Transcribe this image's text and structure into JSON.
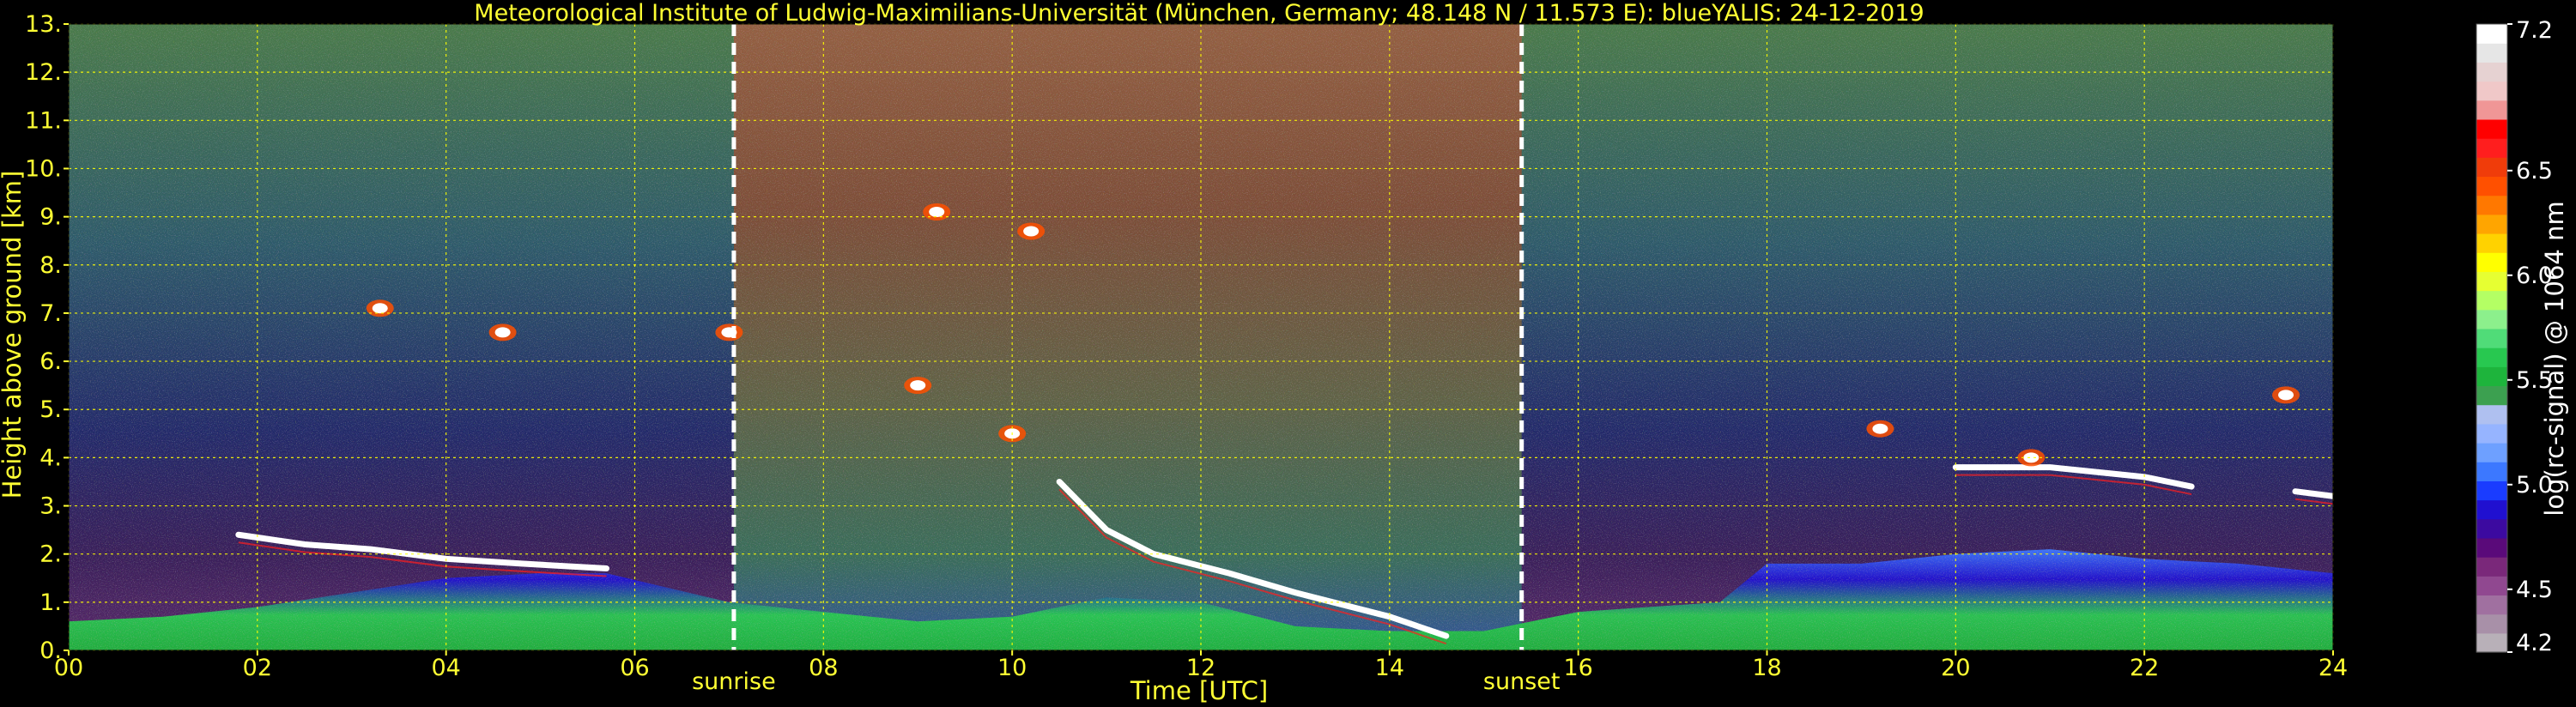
{
  "chart_data": {
    "type": "heatmap",
    "title": "Meteorological Institute of Ludwig-Maximilians-Universität (München, Germany; 48.148 N / 11.573 E):    blueYALIS: 24-12-2019",
    "xlabel": "Time [UTC]",
    "ylabel": "Height above ground [km]",
    "xlim": [
      0,
      24
    ],
    "ylim": [
      0,
      13
    ],
    "x_ticks": [
      {
        "value": 0,
        "label": "00"
      },
      {
        "value": 2,
        "label": "02"
      },
      {
        "value": 4,
        "label": "04"
      },
      {
        "value": 6,
        "label": "06"
      },
      {
        "value": 8,
        "label": "08"
      },
      {
        "value": 10,
        "label": "10"
      },
      {
        "value": 12,
        "label": "12"
      },
      {
        "value": 14,
        "label": "14"
      },
      {
        "value": 16,
        "label": "16"
      },
      {
        "value": 18,
        "label": "18"
      },
      {
        "value": 20,
        "label": "20"
      },
      {
        "value": 22,
        "label": "22"
      },
      {
        "value": 24,
        "label": "24"
      }
    ],
    "y_ticks": [
      {
        "value": 0,
        "label": "0."
      },
      {
        "value": 1,
        "label": "1."
      },
      {
        "value": 2,
        "label": "2."
      },
      {
        "value": 3,
        "label": "3."
      },
      {
        "value": 4,
        "label": "4."
      },
      {
        "value": 5,
        "label": "5."
      },
      {
        "value": 6,
        "label": "6."
      },
      {
        "value": 7,
        "label": "7."
      },
      {
        "value": 8,
        "label": "8."
      },
      {
        "value": 9,
        "label": "9."
      },
      {
        "value": 10,
        "label": "10."
      },
      {
        "value": 11,
        "label": "11."
      },
      {
        "value": 12,
        "label": "12."
      },
      {
        "value": 13,
        "label": "13."
      }
    ],
    "grid": true,
    "grid_color": "#ffff00",
    "markers": [
      {
        "label": "sunrise",
        "time": 7.05
      },
      {
        "label": "sunset",
        "time": 15.4
      }
    ],
    "colorbar": {
      "label": "log(rc-signal) @ 1064 nm",
      "range": [
        4.2,
        7.2
      ],
      "ticks": [
        {
          "value": 4.2,
          "label": "4.2"
        },
        {
          "value": 4.5,
          "label": "4.5"
        },
        {
          "value": 5.0,
          "label": "5.0"
        },
        {
          "value": 5.5,
          "label": "5.5"
        },
        {
          "value": 6.0,
          "label": "6.0"
        },
        {
          "value": 6.5,
          "label": "6.5"
        },
        {
          "value": 7.2,
          "label": "7.2"
        }
      ],
      "colors": [
        "#b8b0b8",
        "#a890a8",
        "#a070a0",
        "#904890",
        "#7a287a",
        "#5a0a7a",
        "#3c0aa0",
        "#2010d0",
        "#1a3cff",
        "#3c78ff",
        "#6ea0ff",
        "#96b4ff",
        "#afc0f0",
        "#3ca050",
        "#1eb43c",
        "#28c850",
        "#50dc78",
        "#8cf08c",
        "#b4ff64",
        "#e6ff32",
        "#ffff00",
        "#ffd200",
        "#ffa500",
        "#ff7800",
        "#ff5000",
        "#f03c0a",
        "#ff1e1e",
        "#ff0000",
        "#f09696",
        "#f0c8c8",
        "#e6d2d2",
        "#e6e6e6",
        "#ffffff"
      ]
    },
    "features": {
      "boundary_layer": [
        [
          0.0,
          0.6
        ],
        [
          1.0,
          0.7
        ],
        [
          2.0,
          0.9
        ],
        [
          3.0,
          1.2
        ],
        [
          4.0,
          1.5
        ],
        [
          5.0,
          1.6
        ],
        [
          5.7,
          1.6
        ],
        [
          7.0,
          1.0
        ],
        [
          8.0,
          0.8
        ],
        [
          9.0,
          0.6
        ],
        [
          10.0,
          0.7
        ],
        [
          11.0,
          1.1
        ],
        [
          12.0,
          1.0
        ],
        [
          13.0,
          0.5
        ],
        [
          14.0,
          0.4
        ],
        [
          15.0,
          0.4
        ],
        [
          16.0,
          0.8
        ],
        [
          17.5,
          1.0
        ],
        [
          18.0,
          1.8
        ],
        [
          19.0,
          1.8
        ],
        [
          20.0,
          2.0
        ],
        [
          21.0,
          2.1
        ],
        [
          22.0,
          1.9
        ],
        [
          23.0,
          1.8
        ],
        [
          24.0,
          1.6
        ]
      ],
      "cloud_lines": [
        [
          [
            1.8,
            2.4
          ],
          [
            2.5,
            2.2
          ],
          [
            3.2,
            2.1
          ],
          [
            4.0,
            1.9
          ],
          [
            4.8,
            1.8
          ],
          [
            5.7,
            1.7
          ]
        ],
        [
          [
            10.5,
            3.5
          ],
          [
            11.0,
            2.5
          ],
          [
            11.5,
            2.0
          ],
          [
            12.3,
            1.6
          ],
          [
            13.0,
            1.2
          ],
          [
            14.0,
            0.7
          ],
          [
            14.6,
            0.3
          ]
        ],
        [
          [
            20.0,
            3.8
          ],
          [
            21.0,
            3.8
          ],
          [
            22.0,
            3.6
          ],
          [
            22.5,
            3.4
          ]
        ],
        [
          [
            23.6,
            3.3
          ],
          [
            24.0,
            3.2
          ]
        ]
      ],
      "cloud_patches": [
        [
          3.3,
          7.1
        ],
        [
          4.6,
          6.6
        ],
        [
          7.0,
          6.6
        ],
        [
          9.2,
          9.1
        ],
        [
          10.2,
          8.7
        ],
        [
          9.0,
          5.5
        ],
        [
          10.0,
          4.5
        ],
        [
          19.2,
          4.6
        ],
        [
          20.8,
          4.0
        ],
        [
          23.5,
          5.3
        ]
      ]
    }
  }
}
